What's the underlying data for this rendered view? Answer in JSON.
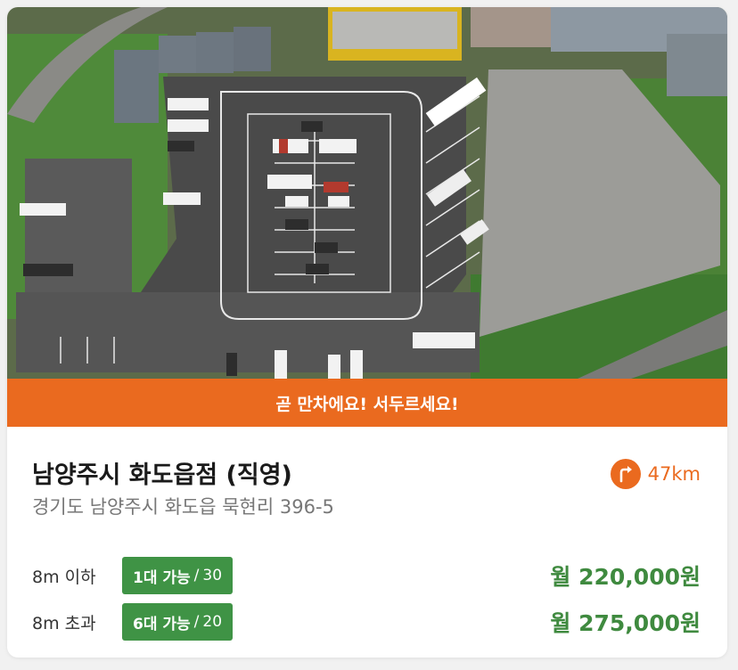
{
  "banner": {
    "text": "곧 만차에요! 서두르세요!"
  },
  "listing": {
    "name": "남양주시 화도읍점 (직영)",
    "address": "경기도 남양주시 화도읍 묵현리 396-5",
    "distance": "47km"
  },
  "plans": [
    {
      "size": "8m 이하",
      "available": "1대 가능",
      "total": "30",
      "price": "월 220,000원"
    },
    {
      "size": "8m 초과",
      "available": "6대 가능",
      "total": "20",
      "price": "월 275,000원"
    }
  ],
  "colors": {
    "accent": "#ea6a1f",
    "green": "#3f9345",
    "price_green": "#3f8a3f"
  },
  "icons": {
    "distance": "directions-turn-icon"
  }
}
